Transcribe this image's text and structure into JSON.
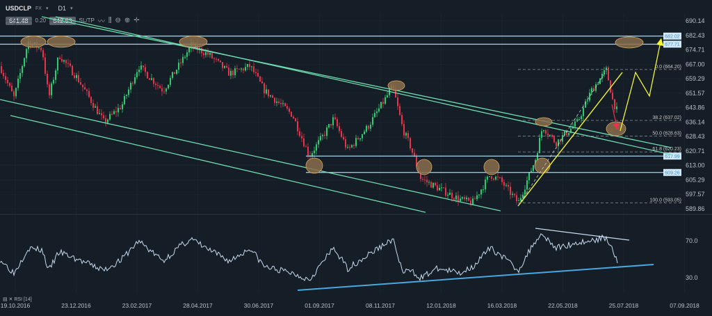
{
  "header": {
    "symbol": "USDCLP",
    "market": "FX",
    "timeframe": "D1",
    "bid": "641.48",
    "spread": "0.20",
    "ask": "642.53",
    "sltp_label": "SL/TP",
    "tools": [
      "line-chart-icon",
      "candles-icon",
      "zoom-out-icon",
      "zoom-in-icon",
      "crosshair-icon"
    ]
  },
  "indicator": {
    "label": "RSI [14]"
  },
  "colors": {
    "up": "#2ecc71",
    "down": "#e8334a",
    "channel": "#6fdcb0",
    "support": "#a8d8f0",
    "arrow": "#f5f532",
    "ellipse": "#8a6f4e",
    "rsi": "#c8dcef",
    "rsi_support": "#4aa8e0"
  },
  "chart_data": {
    "type": "candlestick",
    "price_axis": {
      "ticks": [
        "690.14",
        "682.43",
        "674.71",
        "667.00",
        "659.29",
        "651.57",
        "643.86",
        "636.14",
        "628.43",
        "620.71",
        "613.00",
        "605.29",
        "597.57",
        "589.86"
      ],
      "range": [
        589.86,
        690.14
      ]
    },
    "date_axis": {
      "ticks": [
        "19.10.2016",
        "23.12.2016",
        "23.02.2017",
        "28.04.2017",
        "30.06.2017",
        "01.09.2017",
        "08.11.2017",
        "12.01.2018",
        "16.03.2018",
        "22.05.2018",
        "25.07.2018",
        "07.09.2018"
      ]
    },
    "price_path": [
      [
        "2016-10-03",
        666
      ],
      [
        "2016-10-18",
        649
      ],
      [
        "2016-11-02",
        679
      ],
      [
        "2016-11-17",
        675
      ],
      [
        "2016-11-24",
        649
      ],
      [
        "2016-12-05",
        672
      ],
      [
        "2016-12-24",
        660
      ],
      [
        "2017-01-22",
        636
      ],
      [
        "2017-02-10",
        645
      ],
      [
        "2017-02-28",
        666
      ],
      [
        "2017-03-26",
        653
      ],
      [
        "2017-04-14",
        668
      ],
      [
        "2017-04-25",
        677
      ],
      [
        "2017-05-14",
        672
      ],
      [
        "2017-06-05",
        662
      ],
      [
        "2017-06-27",
        666
      ],
      [
        "2017-07-12",
        653
      ],
      [
        "2017-08-11",
        640
      ],
      [
        "2017-08-29",
        618
      ],
      [
        "2017-09-13",
        629
      ],
      [
        "2017-09-24",
        638
      ],
      [
        "2017-10-09",
        621
      ],
      [
        "2017-10-31",
        634
      ],
      [
        "2017-11-26",
        655
      ],
      [
        "2017-12-07",
        632
      ],
      [
        "2017-12-15",
        623
      ],
      [
        "2017-12-26",
        606
      ],
      [
        "2018-01-13",
        601
      ],
      [
        "2018-02-05",
        595
      ],
      [
        "2018-02-19",
        593
      ],
      [
        "2018-03-10",
        608
      ],
      [
        "2018-03-21",
        605
      ],
      [
        "2018-04-09",
        593
      ],
      [
        "2018-04-27",
        616
      ],
      [
        "2018-05-05",
        634
      ],
      [
        "2018-05-19",
        625
      ],
      [
        "2018-06-11",
        636
      ],
      [
        "2018-06-26",
        653
      ],
      [
        "2018-07-12",
        664
      ],
      [
        "2018-07-19",
        647
      ],
      [
        "2018-07-24",
        641.48
      ]
    ],
    "rsi": {
      "ticks": [
        "70.0",
        "30.0"
      ],
      "values": [
        50,
        35,
        62,
        60,
        38,
        58,
        50,
        38,
        50,
        70,
        48,
        65,
        72,
        60,
        48,
        62,
        42,
        35,
        28,
        48,
        62,
        40,
        55,
        72,
        35,
        38,
        30,
        40,
        35,
        42,
        62,
        55,
        38,
        70,
        78,
        62,
        68,
        70,
        74,
        60,
        48
      ]
    },
    "horizontal_levels": [
      {
        "label": "682.02",
        "value": 682.02
      },
      {
        "label": "677.71",
        "value": 677.71
      },
      {
        "label": "617.99",
        "value": 617.99
      },
      {
        "label": "609.26",
        "value": 609.26
      }
    ],
    "fibonacci": [
      {
        "label": "0.0 (664.20)",
        "value": 664.2
      },
      {
        "label": "38.2 (637.02)",
        "value": 637.02
      },
      {
        "label": "50.0 (628.63)",
        "value": 628.63
      },
      {
        "label": "61.8 (620.23)",
        "value": 620.23
      },
      {
        "label": "100.0 (593.05)",
        "value": 593.05
      }
    ]
  }
}
